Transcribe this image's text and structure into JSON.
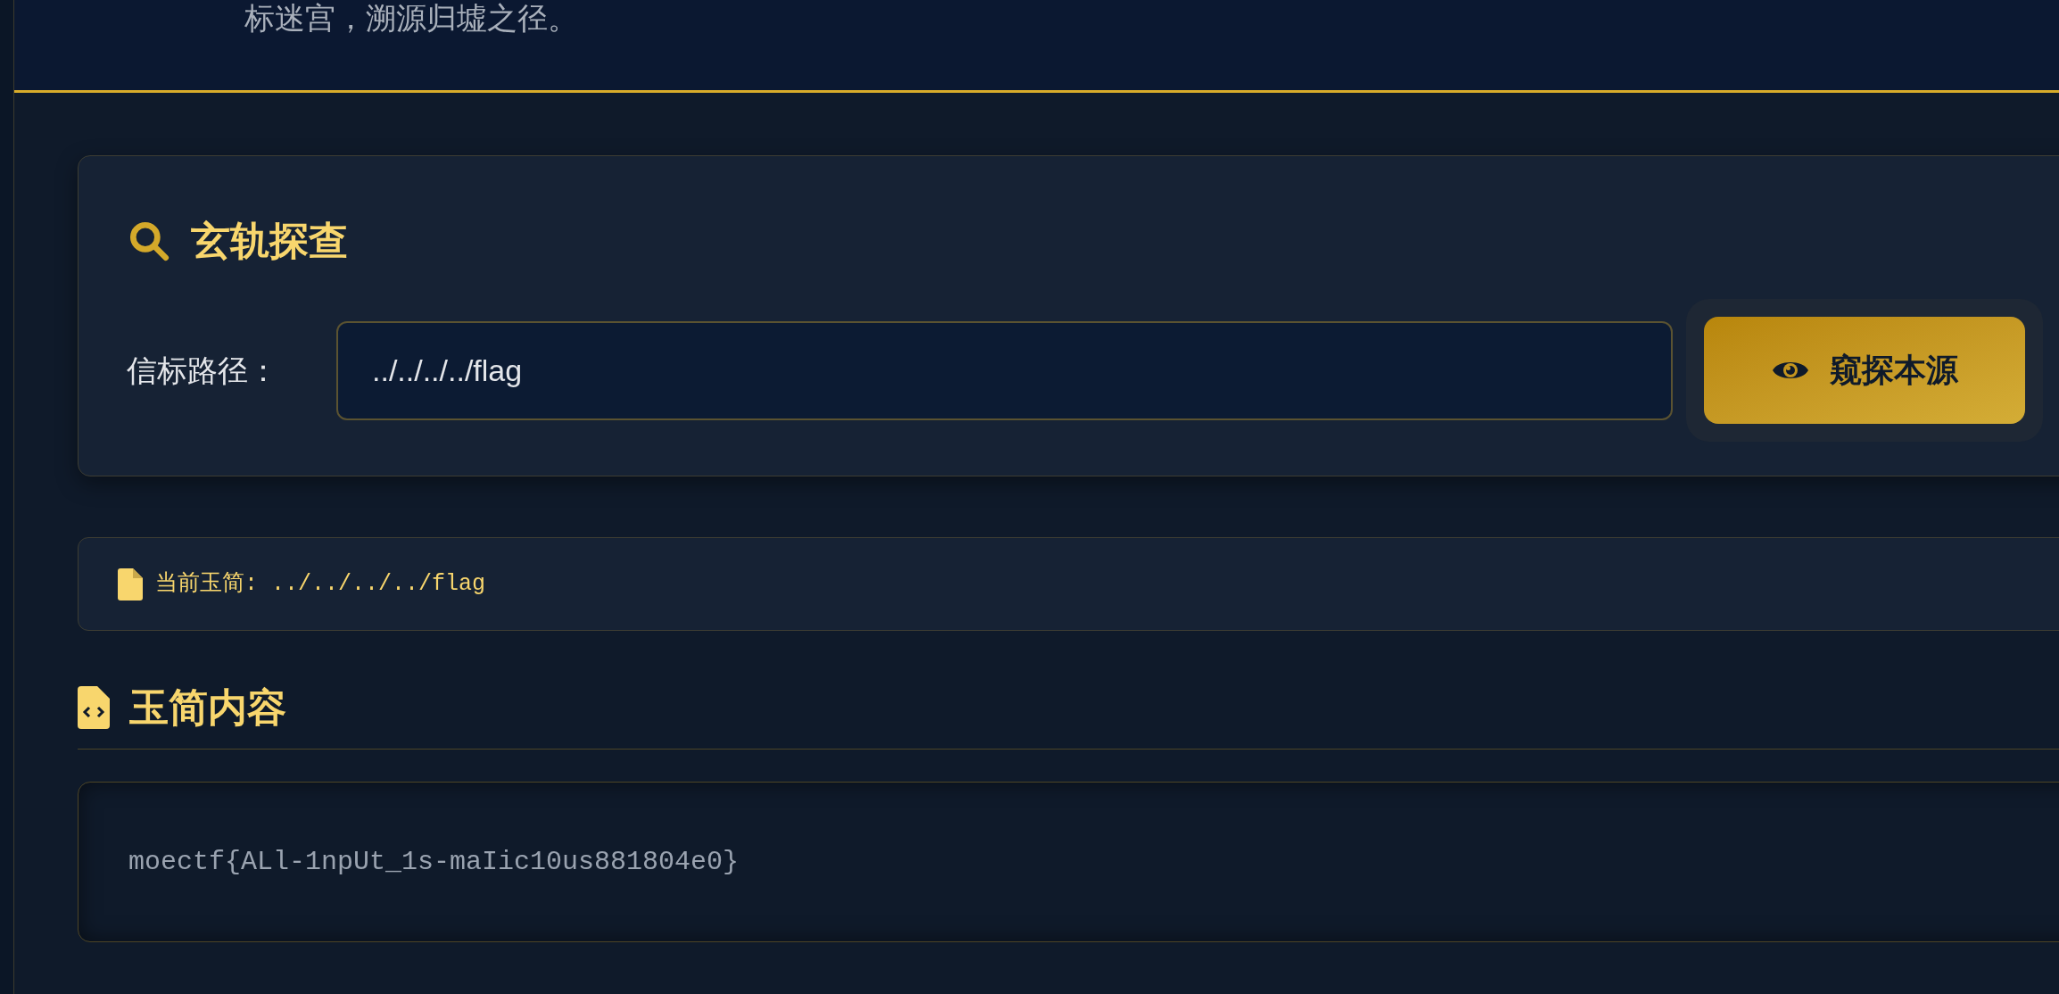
{
  "header": {
    "subtitle": "标迷宫，溯源归墟之径。"
  },
  "search_card": {
    "title": "玄轨探查",
    "label": "信标路径：",
    "input_value": "../../../../flag",
    "button": "窥探本源"
  },
  "current_file": {
    "text": "当前玉简: ../../../../flag"
  },
  "content_section": {
    "title": "玉简内容",
    "code": "moectf{ALl-1npUt_1s-maIic10us881804e0}"
  }
}
